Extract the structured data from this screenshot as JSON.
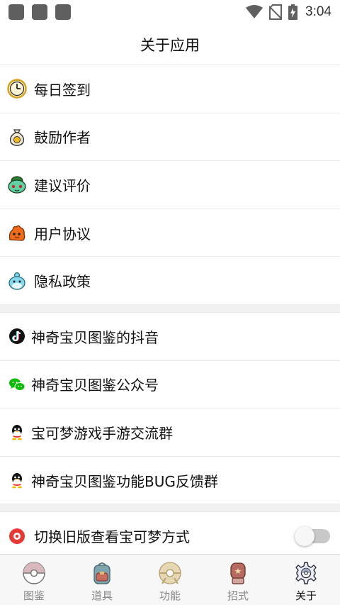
{
  "status_bar": {
    "time": "3:04",
    "icons": [
      "notification-square-icon",
      "notification-square-icon",
      "notification-square-icon",
      "wifi-icon",
      "no-sim-icon",
      "battery-charging-icon"
    ]
  },
  "header": {
    "title": "关于应用"
  },
  "group1": [
    {
      "label": "每日签到",
      "icon": "clock-icon"
    },
    {
      "label": "鼓励作者",
      "icon": "money-bag-icon"
    },
    {
      "label": "建议评价",
      "icon": "bulbasaur-icon"
    },
    {
      "label": "用户协议",
      "icon": "slugma-icon"
    },
    {
      "label": "隐私政策",
      "icon": "spheal-icon"
    }
  ],
  "group2": [
    {
      "label": "神奇宝贝图鉴的抖音",
      "icon": "tiktok-icon"
    },
    {
      "label": "神奇宝贝图鉴公众号",
      "icon": "wechat-icon"
    },
    {
      "label": "宝可梦游戏手游交流群",
      "icon": "qq-icon"
    },
    {
      "label": "神奇宝贝图鉴功能BUG反馈群",
      "icon": "qq-icon"
    }
  ],
  "setting": {
    "label": "切换旧版查看宝可梦方式",
    "icon": "pokeball-icon",
    "toggle_on": false
  },
  "tabs": [
    {
      "label": "图鉴",
      "icon": "pokeball-icon",
      "active": false
    },
    {
      "label": "道具",
      "icon": "backpack-icon",
      "active": false
    },
    {
      "label": "功能",
      "icon": "gear-pokeball-icon",
      "active": false
    },
    {
      "label": "招式",
      "icon": "boxing-glove-icon",
      "active": false
    },
    {
      "label": "关于",
      "icon": "settings-gear-icon",
      "active": true
    }
  ],
  "colors": {
    "accent_red": "#e53935",
    "wechat_green": "#09bb07",
    "divider": "#ececec",
    "tab_active": "#111111",
    "tab_inactive": "#888888"
  }
}
